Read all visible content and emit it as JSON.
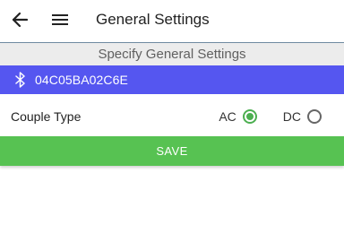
{
  "toolbar": {
    "title": "General Settings",
    "back_icon": "arrow-left-icon",
    "menu_icon": "hamburger-menu-icon"
  },
  "section": {
    "header": "Specify General Settings"
  },
  "device": {
    "icon": "bluetooth-icon",
    "id": "04C05BA02C6E",
    "bar_color": "#5556f0"
  },
  "couple_type": {
    "label": "Couple Type",
    "options": [
      {
        "label": "AC",
        "selected": true
      },
      {
        "label": "DC",
        "selected": false
      }
    ],
    "selected_color": "#4caf50"
  },
  "save": {
    "label": "SAVE",
    "color": "#57c252"
  }
}
